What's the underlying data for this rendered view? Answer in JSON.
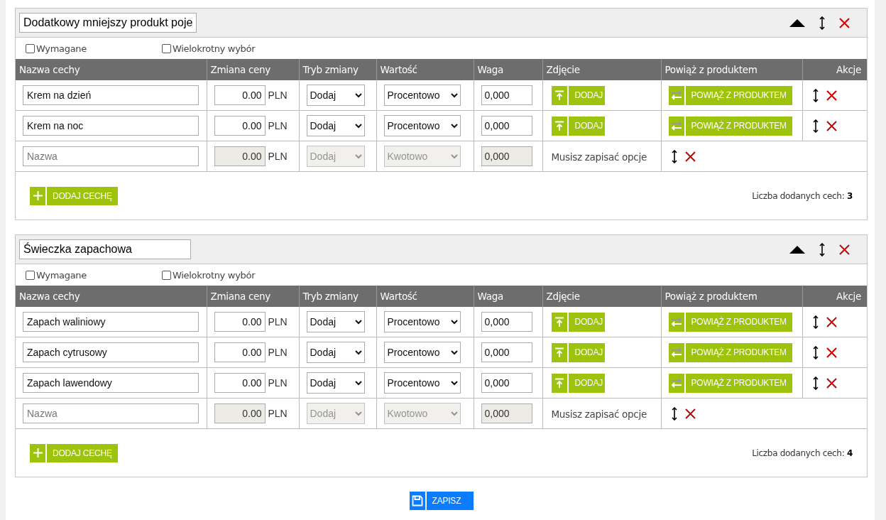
{
  "groups": [
    {
      "title": "Dodatkowy mniejszy produkt poje",
      "options": [
        {
          "label": "Wymagane",
          "checked": false
        },
        {
          "label": "Wielokrotny wybór",
          "checked": false
        }
      ],
      "columns": [
        "Nazwa cechy",
        "Zmiana ceny",
        "Tryb zmiany",
        "Wartość",
        "Waga",
        "Zdjęcie",
        "Powiąż z produktem",
        "Akcje"
      ],
      "rows": [
        {
          "kind": "feature",
          "name": "Krem na dzień",
          "price": "0.00",
          "currency": "PLN",
          "mode": "Dodaj",
          "value_type": "Procentowo",
          "weight": "0,000",
          "photo_button": "DODAJ",
          "link_button": "POWIĄŻ Z PRODUKTEM"
        },
        {
          "kind": "feature",
          "name": "Krem na noc",
          "price": "0.00",
          "currency": "PLN",
          "mode": "Dodaj",
          "value_type": "Procentowo",
          "weight": "0,000",
          "photo_button": "DODAJ",
          "link_button": "POWIĄŻ Z PRODUKTEM"
        },
        {
          "kind": "new",
          "placeholder": "Nazwa",
          "price": "0.00",
          "currency": "PLN",
          "mode": "Dodaj",
          "value_type": "Kwotowo",
          "weight": "0,000",
          "message": "Musisz zapisać opcje"
        }
      ],
      "add_button": "DODAJ CECHĘ",
      "summary": "Liczba dodanych cech: **3**"
    },
    {
      "title": "Świeczka zapachowa",
      "options": [
        {
          "label": "Wymagane",
          "checked": false
        },
        {
          "label": "Wielokrotny wybór",
          "checked": false
        }
      ],
      "columns": [
        "Nazwa cechy",
        "Zmiana ceny",
        "Tryb zmiany",
        "Wartość",
        "Waga",
        "Zdjęcie",
        "Powiąż z produktem",
        "Akcje"
      ],
      "rows": [
        {
          "kind": "feature",
          "name": "Zapach waliniowy",
          "price": "0.00",
          "currency": "PLN",
          "mode": "Dodaj",
          "value_type": "Procentowo",
          "weight": "0,000",
          "photo_button": "DODAJ",
          "link_button": "POWIĄŻ Z PRODUKTEM"
        },
        {
          "kind": "feature",
          "name": "Zapach cytrusowy",
          "price": "0.00",
          "currency": "PLN",
          "mode": "Dodaj",
          "value_type": "Procentowo",
          "weight": "0,000",
          "photo_button": "DODAJ",
          "link_button": "POWIĄŻ Z PRODUKTEM"
        },
        {
          "kind": "feature",
          "name": "Zapach lawendowy",
          "price": "0.00",
          "currency": "PLN",
          "mode": "Dodaj",
          "value_type": "Procentowo",
          "weight": "0,000",
          "photo_button": "DODAJ",
          "link_button": "POWIĄŻ Z PRODUKTEM"
        },
        {
          "kind": "new",
          "placeholder": "Nazwa",
          "price": "0.00",
          "currency": "PLN",
          "mode": "Dodaj",
          "value_type": "Kwotowo",
          "weight": "0,000",
          "message": "Musisz zapisać opcje"
        }
      ],
      "add_button": "DODAJ CECHĘ",
      "summary": "Liczba dodanych cech: **4**"
    }
  ],
  "save_button": "ZAPISZ"
}
